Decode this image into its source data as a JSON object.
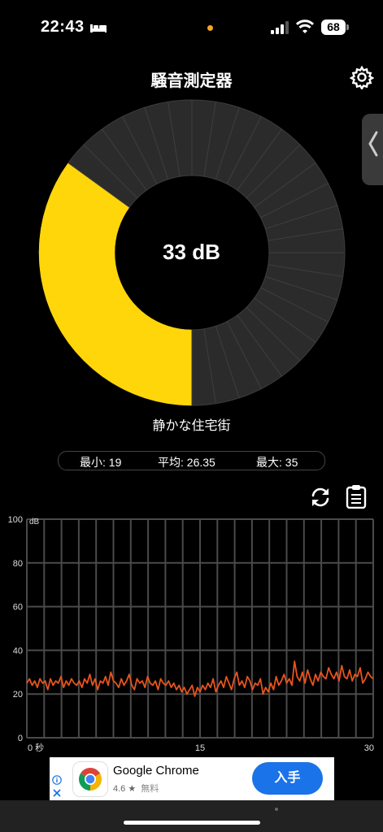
{
  "status_bar": {
    "time": "22:43",
    "battery": "68"
  },
  "header": {
    "title": "騒音測定器"
  },
  "gauge": {
    "value_text": "33 dB",
    "level_fraction": 0.33,
    "segments": 40,
    "description": "静かな住宅街",
    "fill_color": "#FFD60A",
    "track_color": "#2b2b2b"
  },
  "stats": {
    "min": "最小: 19",
    "avg": "平均: 26.35",
    "max": "最大: 35"
  },
  "chart_data": {
    "type": "line",
    "ylabel": "dB",
    "ylim": [
      0,
      100
    ],
    "xlim": [
      0,
      30
    ],
    "y_ticks": [
      "0",
      "20",
      "40",
      "60",
      "80",
      "100"
    ],
    "x_ticks": [
      {
        "value": 0,
        "label": "0 秒"
      },
      {
        "value": 15,
        "label": "15"
      },
      {
        "value": 30,
        "label": "30"
      }
    ],
    "grid": true,
    "line_color": "#E8541E",
    "series": [
      {
        "values": [
          25,
          27,
          24,
          26,
          23,
          27,
          25,
          26,
          22,
          27,
          24,
          26,
          25,
          28,
          23,
          26,
          24,
          27,
          25,
          24,
          26,
          23,
          27,
          25,
          29,
          24,
          27,
          22,
          26,
          25,
          28,
          24,
          30,
          26,
          25,
          23,
          27,
          24,
          26,
          29,
          24,
          22,
          27,
          25,
          26,
          23,
          28,
          25,
          24,
          26,
          22,
          27,
          25,
          24,
          26,
          23,
          25,
          22,
          24,
          21,
          23,
          20,
          22,
          24,
          19,
          23,
          21,
          24,
          22,
          25,
          23,
          27,
          21,
          24,
          26,
          23,
          28,
          25,
          22,
          27,
          30,
          24,
          26,
          23,
          28,
          26,
          22,
          25,
          24,
          27,
          20,
          23,
          21,
          25,
          22,
          28,
          24,
          26,
          29,
          25,
          27,
          24,
          35,
          28,
          26,
          30,
          25,
          31,
          27,
          24,
          29,
          26,
          30,
          28,
          27,
          32,
          29,
          27,
          30,
          26,
          33,
          28,
          27,
          31,
          26,
          29,
          28,
          32,
          25,
          27,
          30,
          28,
          27
        ]
      }
    ]
  },
  "ad": {
    "app_name": "Google Chrome",
    "rating": "4.6",
    "price": "無料",
    "button": "入手"
  }
}
